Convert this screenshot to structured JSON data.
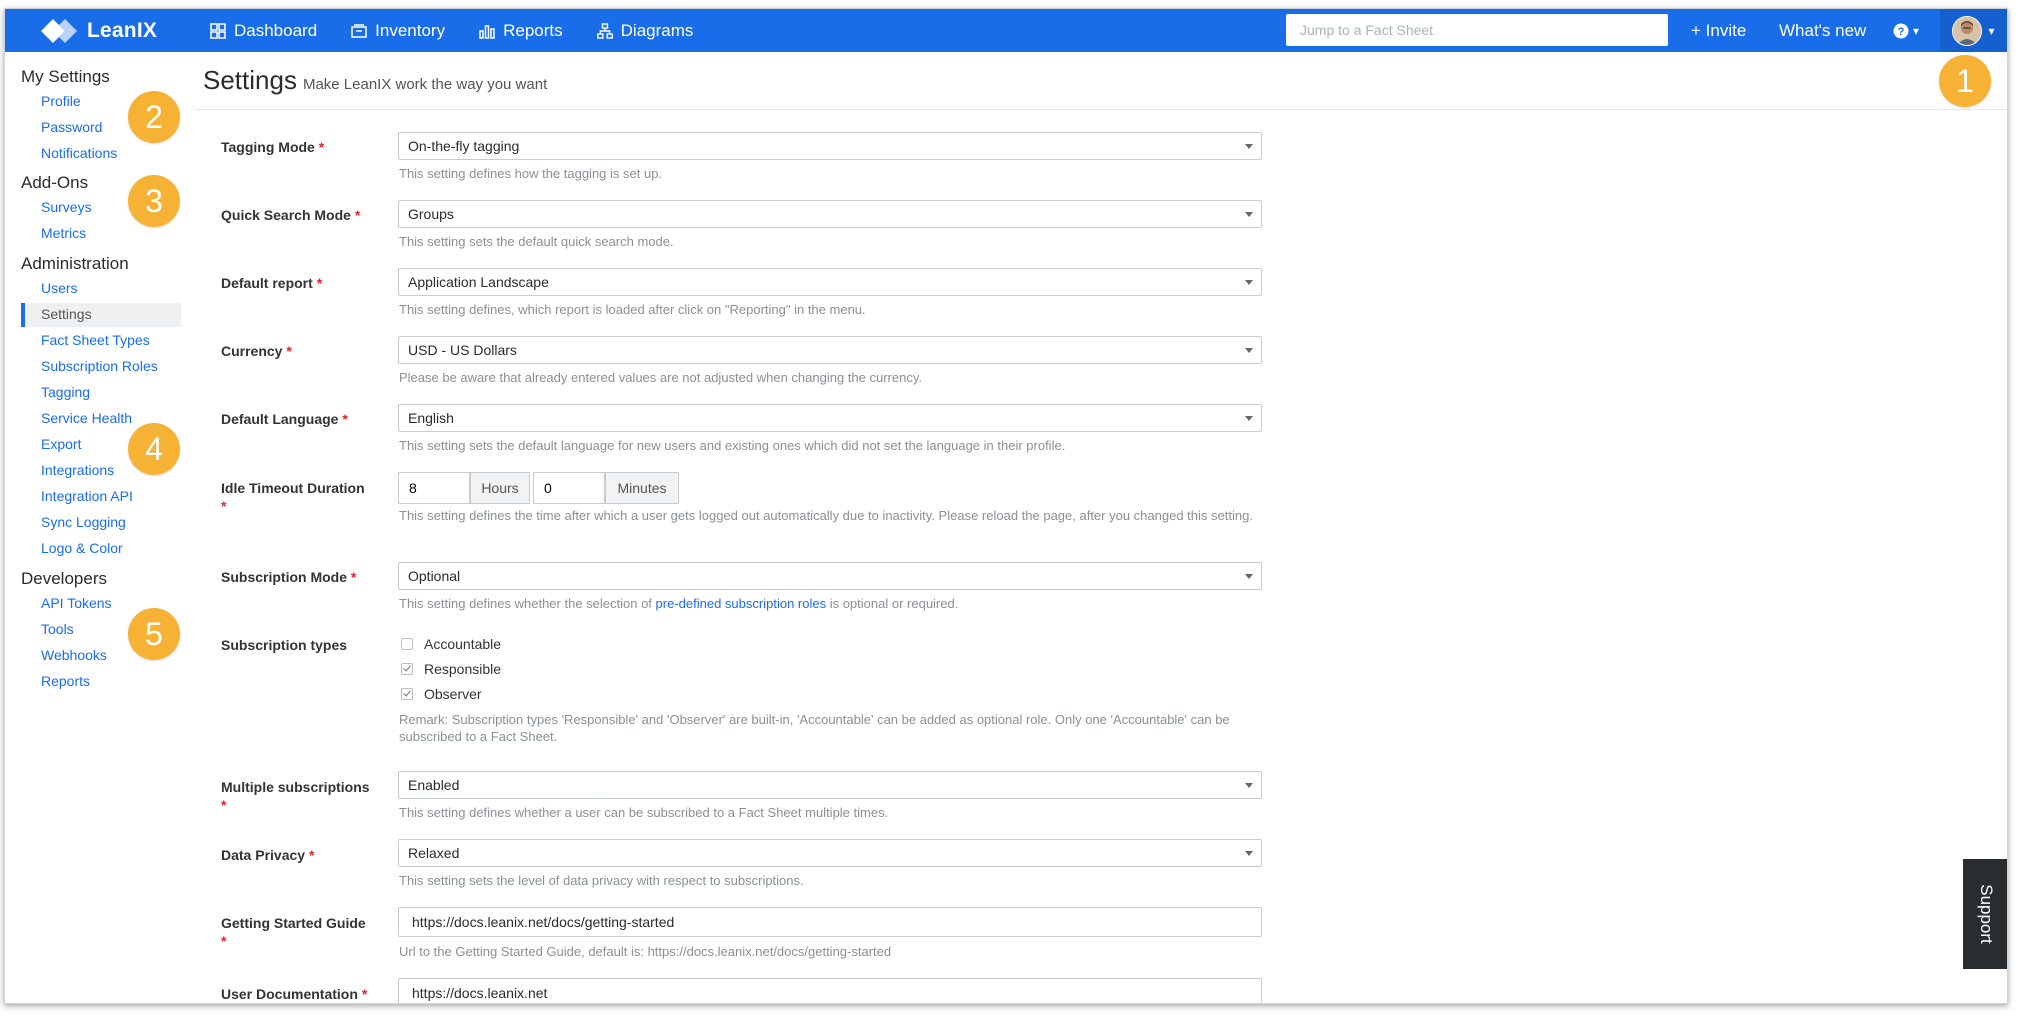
{
  "topbar": {
    "brand": "LeanIX",
    "nav": [
      {
        "label": "Dashboard",
        "icon": "dashboard-icon"
      },
      {
        "label": "Inventory",
        "icon": "inventory-icon"
      },
      {
        "label": "Reports",
        "icon": "reports-icon"
      },
      {
        "label": "Diagrams",
        "icon": "diagrams-icon"
      }
    ],
    "search_placeholder": "Jump to a Fact Sheet",
    "invite": "+ Invite",
    "whats_new": "What's new",
    "help_caret": "▾",
    "colors": {
      "bar": "#1a6de8",
      "accent_badge": "#f6b235"
    }
  },
  "sidebar": {
    "my_settings": {
      "title": "My Settings",
      "items": [
        "Profile",
        "Password",
        "Notifications"
      ]
    },
    "addons": {
      "title": "Add-Ons",
      "items": [
        "Surveys",
        "Metrics"
      ]
    },
    "administration": {
      "title": "Administration",
      "items": [
        "Users",
        "Settings",
        "Fact Sheet Types",
        "Subscription Roles",
        "Tagging",
        "Service Health",
        "Export",
        "Integrations",
        "Integration API",
        "Sync Logging",
        "Logo & Color"
      ],
      "active": "Settings"
    },
    "developers": {
      "title": "Developers",
      "items": [
        "API Tokens",
        "Tools",
        "Webhooks",
        "Reports"
      ]
    }
  },
  "page": {
    "title": "Settings",
    "subtitle": "Make LeanIX work the way you want"
  },
  "form": {
    "tagging_mode": {
      "label": "Tagging Mode",
      "value": "On-the-fly tagging",
      "help": "This setting defines how the tagging is set up."
    },
    "quick_search": {
      "label": "Quick Search Mode",
      "value": "Groups",
      "help": "This setting sets the default quick search mode."
    },
    "default_report": {
      "label": "Default report",
      "value": "Application Landscape",
      "help": "This setting defines, which report is loaded after click on \"Reporting\" in the menu."
    },
    "currency": {
      "label": "Currency",
      "value": "USD - US Dollars",
      "help": "Please be aware that already entered values are not adjusted when changing the currency."
    },
    "default_language": {
      "label": "Default Language",
      "value": "English",
      "help": "This setting sets the default language for new users and existing ones which did not set the language in their profile."
    },
    "idle_timeout": {
      "label": "Idle Timeout Duration",
      "hours_value": "8",
      "hours_unit": "Hours",
      "minutes_value": "0",
      "minutes_unit": "Minutes",
      "help": "This setting defines the time after which a user gets logged out automatically due to inactivity. Please reload the page, after you changed this setting."
    },
    "subscription_mode": {
      "label": "Subscription Mode",
      "value": "Optional",
      "help_pre": "This setting defines whether the selection of ",
      "help_link": "pre-defined subscription roles",
      "help_post": " is optional or required."
    },
    "subscription_types": {
      "label": "Subscription types",
      "options": [
        {
          "label": "Accountable",
          "checked": false
        },
        {
          "label": "Responsible",
          "checked": true
        },
        {
          "label": "Observer",
          "checked": true
        }
      ],
      "remark": "Remark: Subscription types 'Responsible' and 'Observer' are built-in, 'Accountable' can be added as optional role. Only one 'Accountable' can be subscribed to a Fact Sheet."
    },
    "multiple_subscriptions": {
      "label": "Multiple subscriptions",
      "value": "Enabled",
      "help": "This setting defines whether a user can be subscribed to a Fact Sheet multiple times."
    },
    "data_privacy": {
      "label": "Data Privacy",
      "value": "Relaxed",
      "help": "This setting sets the level of data privacy with respect to subscriptions."
    },
    "getting_started": {
      "label": "Getting Started Guide",
      "value": "https://docs.leanix.net/docs/getting-started",
      "help": "Url to the Getting Started Guide, default is: https://docs.leanix.net/docs/getting-started"
    },
    "user_docs": {
      "label": "User Documentation",
      "value": "https://docs.leanix.net"
    }
  },
  "badges": [
    "1",
    "2",
    "3",
    "4",
    "5"
  ],
  "support": "Support"
}
